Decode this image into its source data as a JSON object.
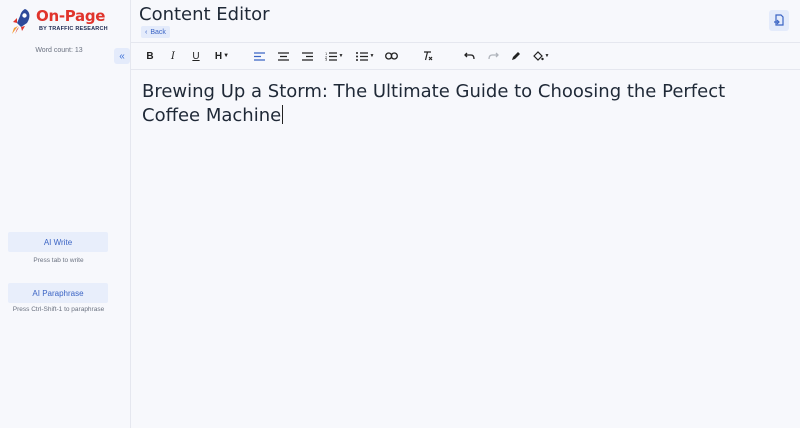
{
  "app": {
    "logo_text": "On-Page",
    "logo_subtext": "BY TRAFFIC RESEARCH"
  },
  "sidebar": {
    "word_count": "Word count: 13",
    "ai_write_label": "AI Write",
    "ai_write_hint": "Press tab to write",
    "ai_paraphrase_label": "AI Paraphrase",
    "ai_paraphrase_hint": "Press Ctrl-Shift-1 to paraphrase"
  },
  "header": {
    "title": "Content Editor",
    "back_label": "Back"
  },
  "toolbar": {
    "bold": "B",
    "italic": "I",
    "underline": "U",
    "heading": "H"
  },
  "editor": {
    "content": "Brewing Up a Storm: The Ultimate Guide to Choosing the Perfect Coffee Machine"
  },
  "colors": {
    "brand_red": "#e0342c",
    "accent_blue": "#3b64c4",
    "button_bg": "#e8eefb"
  }
}
